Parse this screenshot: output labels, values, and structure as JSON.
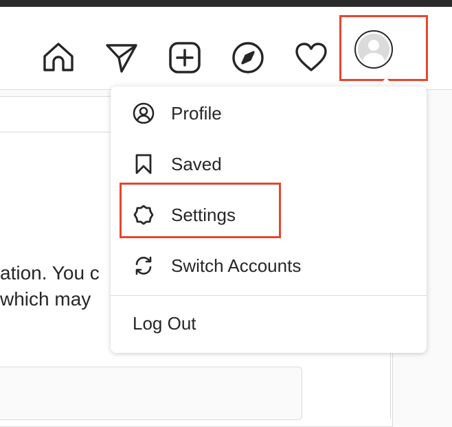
{
  "navbar": {
    "icons": [
      "home-icon",
      "direct-messages-icon",
      "new-post-icon",
      "explore-icon",
      "activity-heart-icon",
      "profile-avatar"
    ]
  },
  "background": {
    "line1": "ation. You c",
    "line2": "which may"
  },
  "menu": {
    "items": [
      {
        "label": "Profile",
        "icon": "profile-icon"
      },
      {
        "label": "Saved",
        "icon": "bookmark-icon"
      },
      {
        "label": "Settings",
        "icon": "settings-icon"
      },
      {
        "label": "Switch Accounts",
        "icon": "switch-accounts-icon"
      }
    ],
    "logout": "Log Out"
  },
  "colors": {
    "highlight": "#e5452d",
    "text": "#262626",
    "border": "#dbdbdb",
    "page_bg": "#fafafa"
  }
}
